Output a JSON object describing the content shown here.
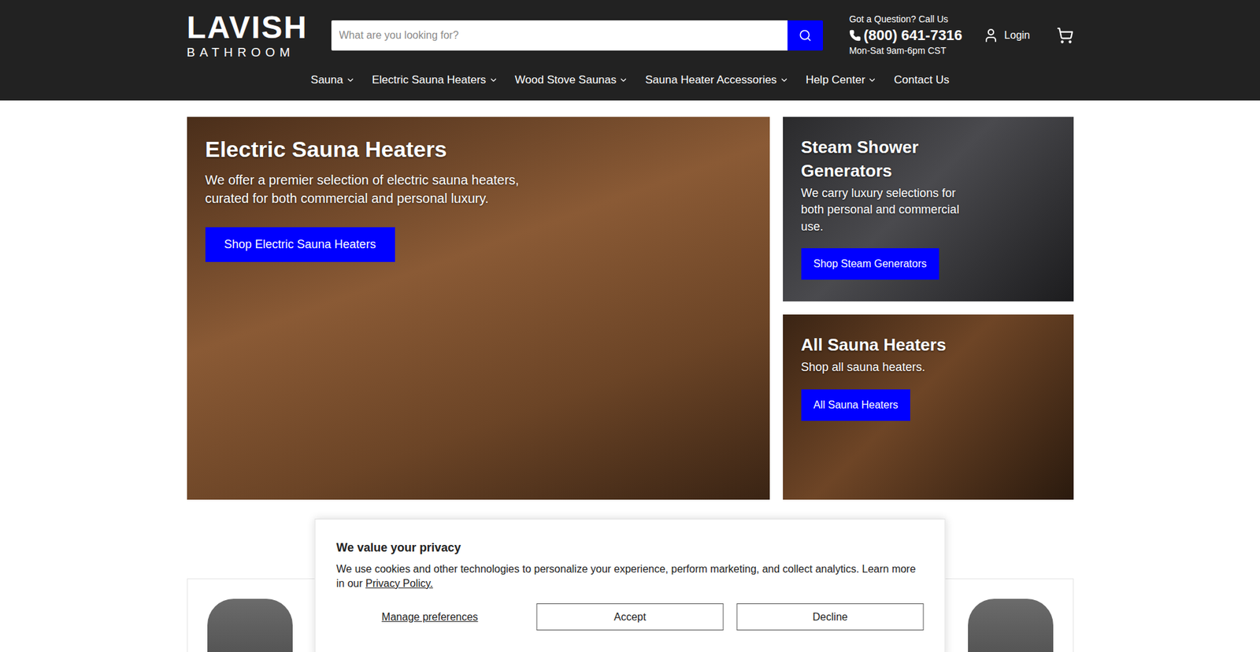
{
  "header": {
    "logo": {
      "primary": "LAVISH",
      "secondary": "BATHROOM"
    },
    "search": {
      "placeholder": "What are you looking for?"
    },
    "contact": {
      "prompt": "Got a Question? Call Us",
      "phone": "(800) 641-7316",
      "hours": "Mon-Sat 9am-6pm CST"
    },
    "login": "Login"
  },
  "nav": [
    {
      "label": "Sauna",
      "has_dropdown": true
    },
    {
      "label": "Electric Sauna Heaters",
      "has_dropdown": true
    },
    {
      "label": "Wood Stove Saunas",
      "has_dropdown": true
    },
    {
      "label": "Sauna Heater Accessories",
      "has_dropdown": true
    },
    {
      "label": "Help Center",
      "has_dropdown": true
    },
    {
      "label": "Contact Us",
      "has_dropdown": false
    }
  ],
  "hero": {
    "main": {
      "title": "Electric Sauna Heaters",
      "text": "We offer a premier selection of electric sauna heaters, curated for both commercial and personal luxury.",
      "button": "Shop Electric Sauna Heaters"
    },
    "side": [
      {
        "title": "Steam Shower Generators",
        "text": "We carry luxury selections for both personal and commercial use.",
        "button": "Shop Steam Generators"
      },
      {
        "title": "All Sauna Heaters",
        "text": "Shop all sauna heaters.",
        "button": "All Sauna Heaters"
      }
    ]
  },
  "cookie_banner": {
    "title": "We value your privacy",
    "text": "We use cookies and other technologies to personalize your experience, perform marketing, and collect analytics. Learn more in our ",
    "link": "Privacy Policy.",
    "buttons": [
      "Manage preferences",
      "Accept",
      "Decline"
    ]
  }
}
